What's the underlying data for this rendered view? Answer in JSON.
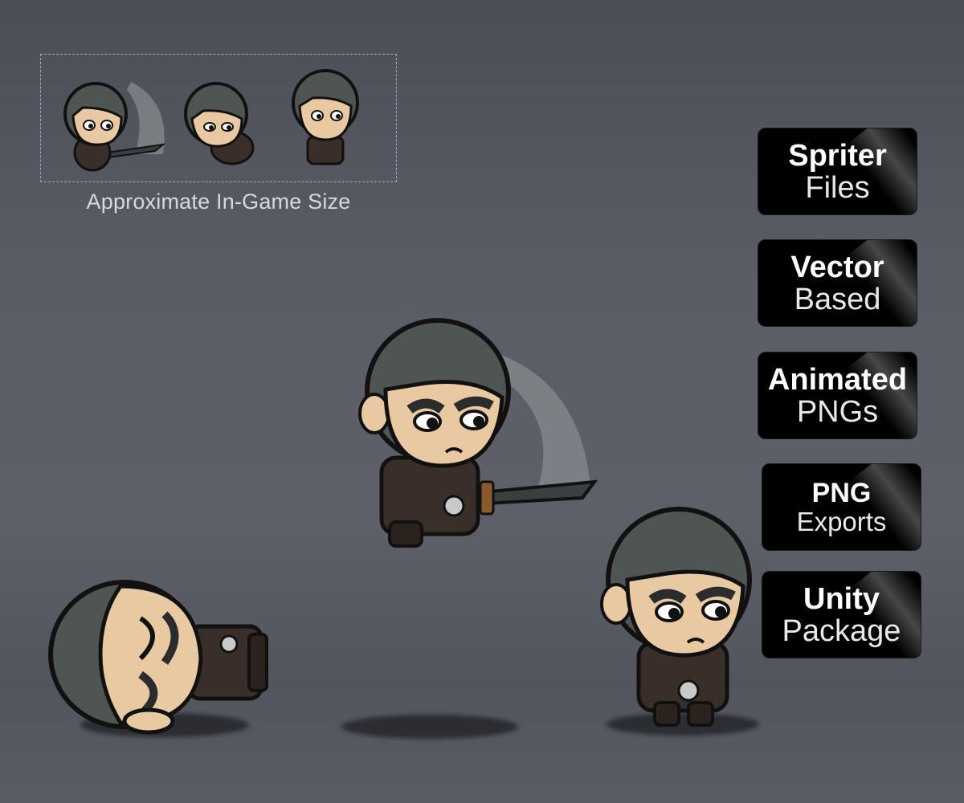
{
  "caption": "Approximate In-Game Size",
  "features": [
    {
      "title": "Spriter",
      "subtitle": "Files"
    },
    {
      "title": "Vector",
      "subtitle": "Based"
    },
    {
      "title": "Animated",
      "subtitle": "PNGs"
    },
    {
      "title": "PNG",
      "subtitle": "Exports"
    },
    {
      "title": "Unity",
      "subtitle": "Package"
    }
  ],
  "colors": {
    "background": "#5b5d66",
    "hair": "#4f5553",
    "skin": "#e9c9a2",
    "outfit": "#3a2f28",
    "outline": "#111111",
    "badge": "#000000",
    "preview_border": "#8fb6c2"
  }
}
